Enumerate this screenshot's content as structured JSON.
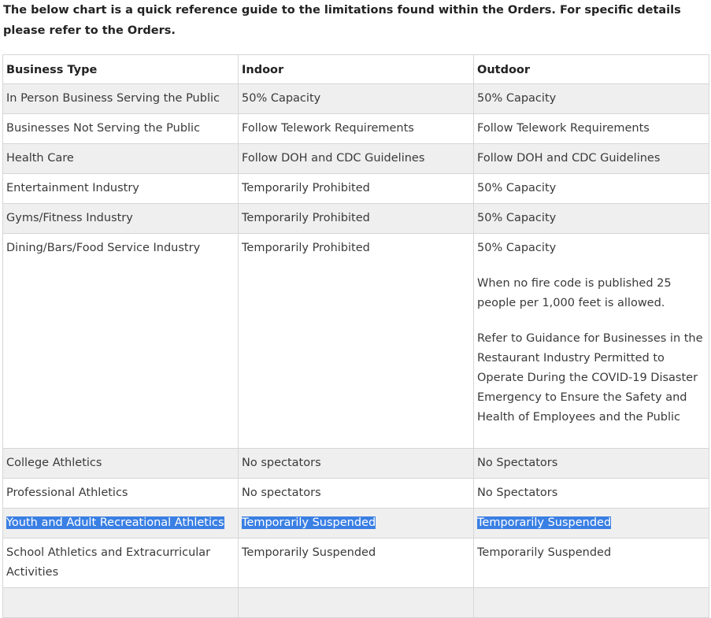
{
  "intro": "The below chart is a quick reference guide to the limitations found within the Orders. For specific details please refer to the Orders.",
  "headers": {
    "business_type": "Business Type",
    "indoor": "Indoor",
    "outdoor": "Outdoor"
  },
  "rows": [
    {
      "business": "In Person Business Serving the Public",
      "indoor": "50% Capacity",
      "outdoor": "50% Capacity"
    },
    {
      "business": "Businesses Not Serving the Public",
      "indoor": "Follow Telework Requirements",
      "outdoor": "Follow Telework Requirements"
    },
    {
      "business": "Health Care",
      "indoor": "Follow DOH and CDC Guidelines",
      "outdoor": "Follow DOH and CDC Guidelines"
    },
    {
      "business": "Entertainment Industry",
      "indoor": "Temporarily Prohibited",
      "outdoor": "50% Capacity"
    },
    {
      "business": "Gyms/Fitness Industry",
      "indoor": "Temporarily Prohibited",
      "outdoor": "50% Capacity"
    },
    {
      "business": "Dining/Bars/Food Service Industry",
      "indoor": "Temporarily Prohibited",
      "outdoor": "50% Capacity",
      "outdoor_note1": "When no fire code is published 25 people per 1,000 feet is allowed.",
      "outdoor_note2": "Refer to Guidance for Businesses in the Restaurant Industry Permitted to Operate During the COVID-19 Disaster Emergency to Ensure the Safety and Health of Employees and the Public"
    },
    {
      "business": "College Athletics",
      "indoor": "No spectators",
      "outdoor": "No Spectators"
    },
    {
      "business": "Professional Athletics",
      "indoor": "No spectators",
      "outdoor": "No Spectators"
    },
    {
      "business": "Youth and Adult Recreational Athletics",
      "indoor": "Temporarily Suspended",
      "outdoor": "Temporarily Suspended"
    },
    {
      "business": "School Athletics and Extracurricular Activities",
      "indoor": "Temporarily Suspended",
      "outdoor": "Temporarily Suspended"
    }
  ],
  "colors": {
    "selection": "#3a7fe3",
    "row_shade": "#efefef",
    "border": "#d6d6d6"
  }
}
